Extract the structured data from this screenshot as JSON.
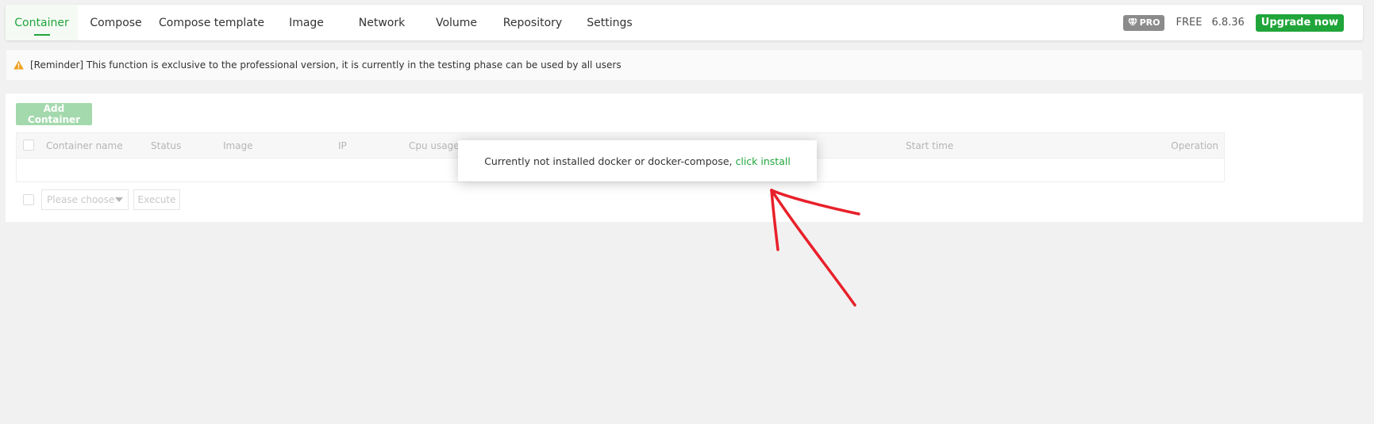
{
  "tabs": [
    {
      "label": "Container",
      "active": true
    },
    {
      "label": "Compose",
      "active": false
    },
    {
      "label": "Compose template",
      "active": false
    },
    {
      "label": "Image",
      "active": false
    },
    {
      "label": "Network",
      "active": false
    },
    {
      "label": "Volume",
      "active": false
    },
    {
      "label": "Repository",
      "active": false
    },
    {
      "label": "Settings",
      "active": false
    }
  ],
  "header": {
    "pro_label": "PRO",
    "free_label": "FREE",
    "version": "6.8.36",
    "upgrade_label": "Upgrade now"
  },
  "reminder": {
    "text": "[Reminder] This function is exclusive to the professional version, it is currently in the testing phase can be used by all users"
  },
  "panel": {
    "add_button": "Add Container",
    "columns": [
      "Container name",
      "Status",
      "Image",
      "IP",
      "Cpu usage",
      "Start time",
      "Operation"
    ],
    "select_placeholder": "Please choose",
    "execute_label": "Execute"
  },
  "modal": {
    "message": "Currently not installed docker or docker-compose, ",
    "link": "click install"
  },
  "colors": {
    "accent": "#20a53a",
    "annotation": "#e8202a",
    "warning": "#f0a020"
  },
  "icons": {
    "pro": "diamond-icon",
    "reminder": "warning-icon"
  }
}
